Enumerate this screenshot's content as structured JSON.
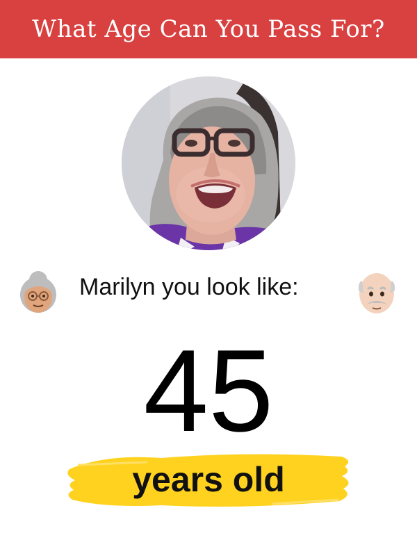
{
  "header": {
    "title": "What Age Can You Pass For?",
    "background_color": "#d94040",
    "text_color": "#ffffff"
  },
  "profile": {
    "photo_icon": "profile-photo"
  },
  "result": {
    "intro_text": "Marilyn you look like:",
    "left_emoji_icon": "grandmother-emoji-icon",
    "right_emoji_icon": "grandfather-emoji-icon",
    "age": "45",
    "unit_text": "years old",
    "highlight_color": "#ffd21f"
  }
}
